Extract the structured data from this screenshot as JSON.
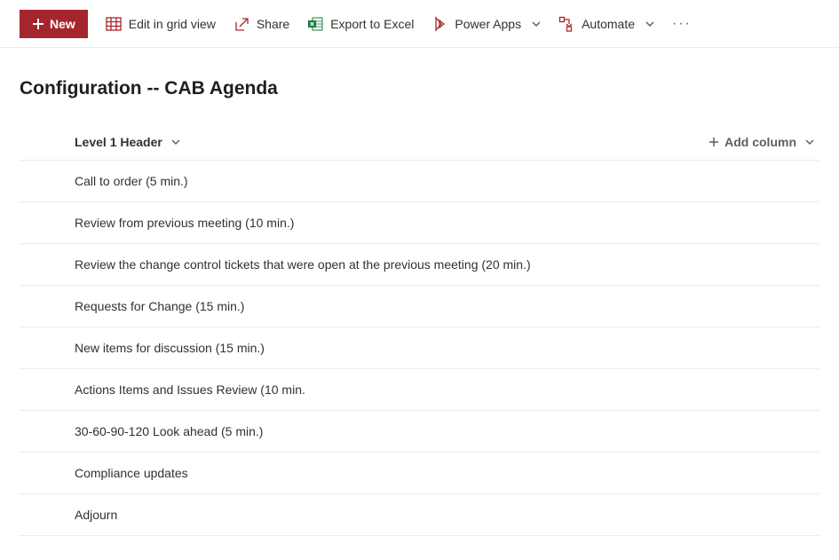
{
  "toolbar": {
    "new_label": "New",
    "edit_grid_label": "Edit in grid view",
    "share_label": "Share",
    "export_label": "Export to Excel",
    "power_apps_label": "Power Apps",
    "automate_label": "Automate",
    "more_label": "···"
  },
  "page": {
    "title": "Configuration -- CAB Agenda"
  },
  "list": {
    "column_header": "Level 1 Header",
    "add_column_label": "Add column",
    "items": [
      {
        "text": "Call to order (5 min.)"
      },
      {
        "text": "Review from previous meeting (10 min.)"
      },
      {
        "text": "Review the change control tickets that were open at the previous meeting (20 min.)"
      },
      {
        "text": "Requests for Change (15 min.)"
      },
      {
        "text": "New items for discussion (15 min.)"
      },
      {
        "text": "Actions Items and Issues Review (10 min."
      },
      {
        "text": "30-60-90-120 Look ahead (5 min.)"
      },
      {
        "text": "Compliance updates"
      },
      {
        "text": "Adjourn"
      }
    ]
  }
}
